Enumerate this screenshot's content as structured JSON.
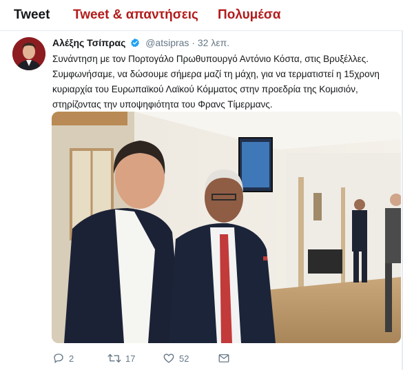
{
  "tabs": [
    {
      "label": "Tweet"
    },
    {
      "label": "Tweet & απαντήσεις"
    },
    {
      "label": "Πολυμέσα"
    }
  ],
  "tweet": {
    "author_name": "Αλέξης Τσίπρας",
    "handle": "@atsipras",
    "separator": "·",
    "time": "32 λεπ.",
    "text_lines": [
      "Συνάντηση με τον Πορτογάλο Πρωθυπουργό Αντόνιο Κόστα, στις Βρυξέλλες.",
      "Συμφωνήσαμε, να δώσουμε σήμερα μαζί τη μάχη, για να τερματιστεί η 15χρονη",
      "κυριαρχία του Ευρωπαϊκού Λαϊκού Κόμματος στην προεδρία της Κομισιόν,",
      "στηρίζοντας την υποψηφιότητα του Φρανς Τίμερμανς."
    ],
    "actions": {
      "replies": "2",
      "retweets": "17",
      "likes": "52"
    }
  },
  "colors": {
    "tab_accent": "#b31b1b",
    "text": "#14171a",
    "muted": "#657786",
    "verified": "#1da1f2",
    "divider": "#e6ecf0"
  },
  "icons": {
    "reply": "reply-icon",
    "retweet": "retweet-icon",
    "like": "heart-icon",
    "message": "envelope-icon",
    "verified": "verified-badge-icon"
  }
}
